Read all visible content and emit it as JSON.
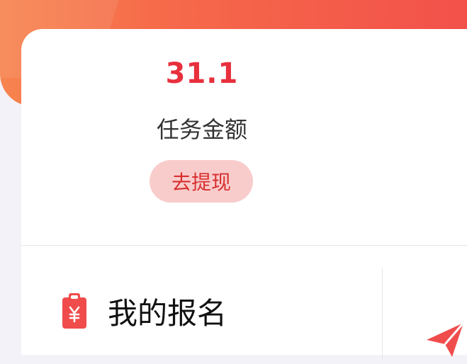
{
  "stats": {
    "amount": "31.1",
    "amount_label": "任务金额",
    "withdraw_label": "去提现"
  },
  "menu": {
    "my_signup_label": "我的报名",
    "my_signup_icon": "clipboard-yen-icon",
    "send_icon": "paper-plane-icon"
  },
  "colors": {
    "header_start": "#f7844f",
    "header_end": "#f2514a",
    "amount": "#e8303d",
    "withdraw_bg": "#f9cccc",
    "withdraw_text": "#d8302f",
    "icon_red": "#f04c4c"
  }
}
